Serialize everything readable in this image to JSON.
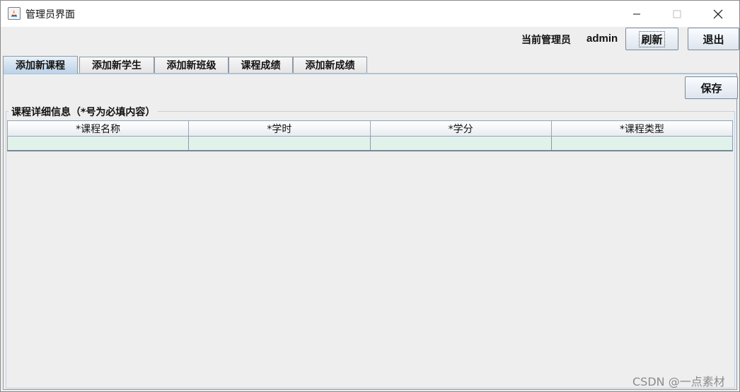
{
  "window": {
    "title": "管理员界面",
    "controls": {
      "minimize": "minimize",
      "maximize": "maximize",
      "close": "close"
    }
  },
  "header": {
    "admin_label": "当前管理员",
    "admin_name": "admin",
    "refresh_label": "刷新",
    "exit_label": "退出"
  },
  "tabs": [
    {
      "label": "添加新课程",
      "active": true
    },
    {
      "label": "添加新学生",
      "active": false
    },
    {
      "label": "添加新班级",
      "active": false
    },
    {
      "label": "课程成绩",
      "active": false
    },
    {
      "label": "添加新成绩",
      "active": false
    }
  ],
  "panel": {
    "save_label": "保存",
    "group_title": "课程详细信息（*号为必填内容）",
    "table": {
      "columns": [
        "*课程名称",
        "*学时",
        "*学分",
        "*课程类型"
      ],
      "rows": [
        [
          "",
          "",
          "",
          ""
        ]
      ]
    }
  },
  "watermark": "CSDN @一点素材",
  "colors": {
    "window_bg": "#eeeeee",
    "active_tab": "#bcd2e8",
    "row_bg": "#e0f2ea"
  }
}
